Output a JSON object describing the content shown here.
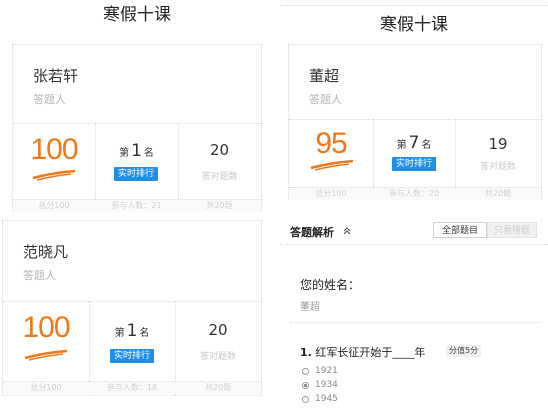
{
  "left_title": "寒假十课",
  "right_title": "寒假十课",
  "cards": [
    {
      "name": "张若轩",
      "role": "答题人",
      "score": "100",
      "rank_prefix": "第",
      "rank": "1",
      "rank_suffix": "名",
      "rank_button": "实时排行",
      "correct_count": "20",
      "correct_label": "答对题数",
      "footer_total": "总分100",
      "footer_participants": "参与人数：21",
      "footer_questions": "共20题"
    },
    {
      "name": "范晓凡",
      "role": "答题人",
      "score": "100",
      "rank_prefix": "第",
      "rank": "1",
      "rank_suffix": "名",
      "rank_button": "实时排行",
      "correct_count": "20",
      "correct_label": "答对题数",
      "footer_total": "总分100",
      "footer_participants": "参与人数：18",
      "footer_questions": "共20题"
    },
    {
      "name": "董超",
      "role": "答题人",
      "score": "95",
      "rank_prefix": "第",
      "rank": "7",
      "rank_suffix": "名",
      "rank_button": "实时排行",
      "correct_count": "19",
      "correct_label": "答对题数",
      "footer_total": "总分100",
      "footer_participants": "参与人数：20",
      "footer_questions": "共20题"
    }
  ],
  "analysis": {
    "title": "答题解析",
    "toggle_icon": "double-chevron-up-icon",
    "tab_all": "全部题目",
    "tab_wrong": "只看错题"
  },
  "questions": [
    {
      "label": "您的姓名：",
      "answer": "董超"
    },
    {
      "number": "1.",
      "text": "红军长征开始于____年",
      "points": "分值5分",
      "options": [
        {
          "text": "1921",
          "selected": false
        },
        {
          "text": "1934",
          "selected": true
        },
        {
          "text": "1945",
          "selected": false
        }
      ]
    }
  ],
  "colors": {
    "score": "#f07818",
    "rank_button": "#1f8fe8"
  }
}
